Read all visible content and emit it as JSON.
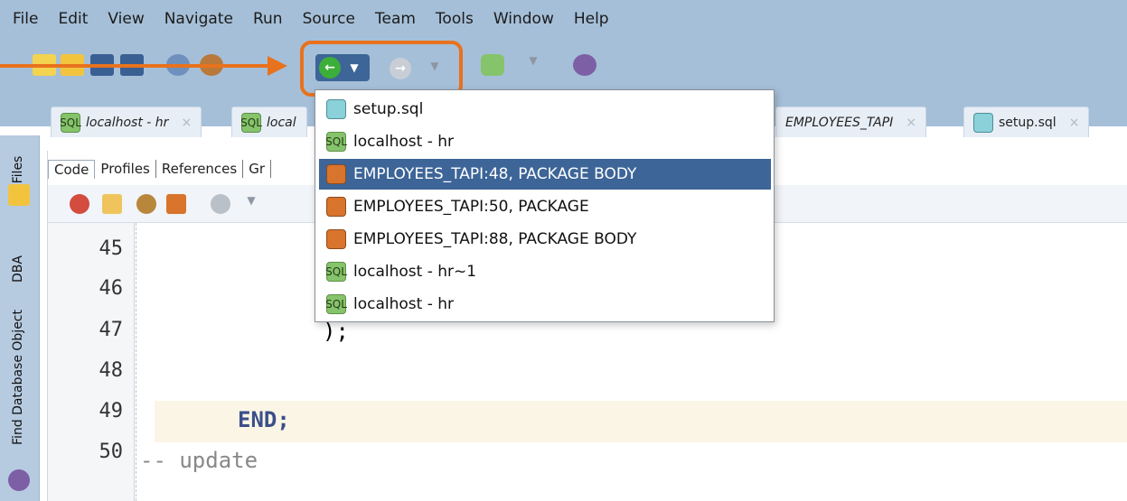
{
  "menubar": {
    "items": [
      "File",
      "Edit",
      "View",
      "Navigate",
      "Run",
      "Source",
      "Team",
      "Tools",
      "Window",
      "Help"
    ]
  },
  "tabs": {
    "items": [
      {
        "label": "localhost - hr",
        "icon": "sql-connection-icon"
      },
      {
        "label": "local",
        "icon": "sql-connection-icon"
      },
      {
        "label": "EMPLOYEES_TAPI",
        "icon": "package-icon"
      },
      {
        "label": "setup.sql",
        "icon": "sql-file-icon"
      }
    ],
    "close_glyph": "×"
  },
  "sidebar": {
    "items": [
      "Files",
      "DBA",
      "Find Database Object"
    ]
  },
  "editor": {
    "subtabs": [
      "Code",
      "Profiles",
      "References",
      "Gr"
    ],
    "line_numbers": [
      "45",
      "46",
      "47",
      "48",
      "49",
      "50"
    ],
    "code_lines": [
      "",
      "",
      ");",
      "",
      "END;",
      "-- update"
    ]
  },
  "dropdown": {
    "items": [
      {
        "label": "setup.sql",
        "icon": "sql-file-icon",
        "selected": false
      },
      {
        "label": "localhost - hr",
        "icon": "sql-connection-icon",
        "selected": false
      },
      {
        "label": "EMPLOYEES_TAPI:48, PACKAGE BODY",
        "icon": "package-icon",
        "selected": true
      },
      {
        "label": "EMPLOYEES_TAPI:50, PACKAGE",
        "icon": "package-icon",
        "selected": false
      },
      {
        "label": "EMPLOYEES_TAPI:88, PACKAGE BODY",
        "icon": "package-icon",
        "selected": false
      },
      {
        "label": "localhost - hr~1",
        "icon": "sql-connection-icon",
        "selected": false
      },
      {
        "label": "localhost - hr",
        "icon": "sql-connection-icon",
        "selected": false
      }
    ]
  },
  "colors": {
    "highlight": "#e8721d",
    "selection": "#3d6597",
    "chrome": "#a5bfd8"
  }
}
